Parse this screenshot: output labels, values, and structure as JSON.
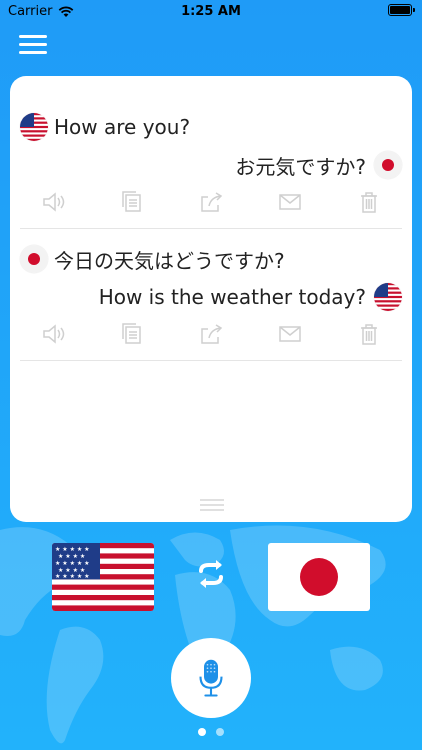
{
  "status_bar": {
    "carrier": "Carrier",
    "time": "1:25 AM"
  },
  "conversation": [
    {
      "source_text": "How are you?",
      "source_lang_icon": "us-flag-icon",
      "translated_text": "お元気ですか?",
      "translated_lang_icon": "japan-flag-icon"
    },
    {
      "source_text": "今日の天気はどうですか?",
      "source_lang_icon": "japan-flag-icon",
      "translated_text": "How is the weather today?",
      "translated_lang_icon": "us-flag-icon"
    }
  ],
  "actions": [
    "speaker-icon",
    "copy-icon",
    "share-icon",
    "mail-icon",
    "trash-icon"
  ],
  "languages": {
    "left": {
      "icon": "us-flag-icon"
    },
    "right": {
      "icon": "japan-flag-icon"
    }
  },
  "pager": {
    "count": 2,
    "active": 0
  },
  "colors": {
    "background_top": "#1f9bf7",
    "background_bottom": "#22b2fb",
    "mic_accent": "#1e90e8",
    "action_icon": "#cfcfcf",
    "japan_red": "#d10d2c"
  }
}
